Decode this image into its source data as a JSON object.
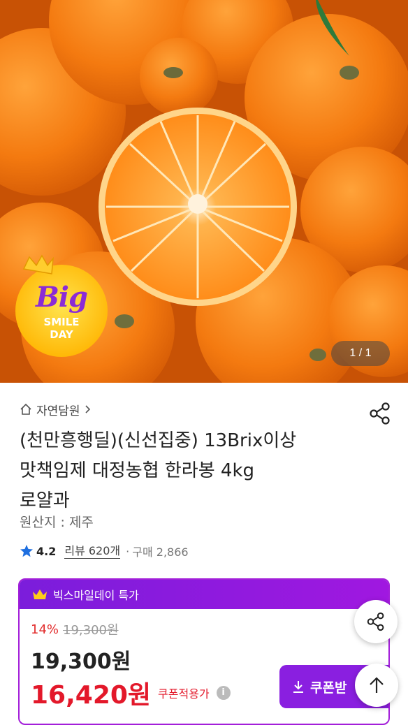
{
  "hero": {
    "badge": {
      "big": "Big",
      "line1": "SMILE",
      "line2": "DAY"
    },
    "counter": "1 / 1"
  },
  "product": {
    "breadcrumb": "자연담원",
    "title_line1": "(천만흥행딜)(신선집중) 13Brix이상",
    "title_line2": "맛책임제 대정농협 한라봉 4kg",
    "title_line3": "로얄과",
    "origin": "원산지 : 제주",
    "rating": "4.2",
    "review": "리뷰 620개",
    "separator": "·",
    "purchases": "구매 2,866"
  },
  "deal": {
    "header": "빅스마일데이 특가",
    "discount_pct": "14%",
    "original_price": "19,300원",
    "price": "19,300원",
    "sale_price": "16,420원",
    "coupon_label": "쿠폰적용가",
    "info": "i",
    "coupon_button": "쿠폰받"
  },
  "colors": {
    "accent_purple": "#8a1fe0",
    "sale_red": "#e3182a",
    "star_blue": "#1e6fe0"
  },
  "icons": [
    "home-icon",
    "chevron-right-icon",
    "share-icon",
    "star-icon",
    "crown-icon",
    "download-icon",
    "info-icon",
    "arrow-up-icon"
  ]
}
